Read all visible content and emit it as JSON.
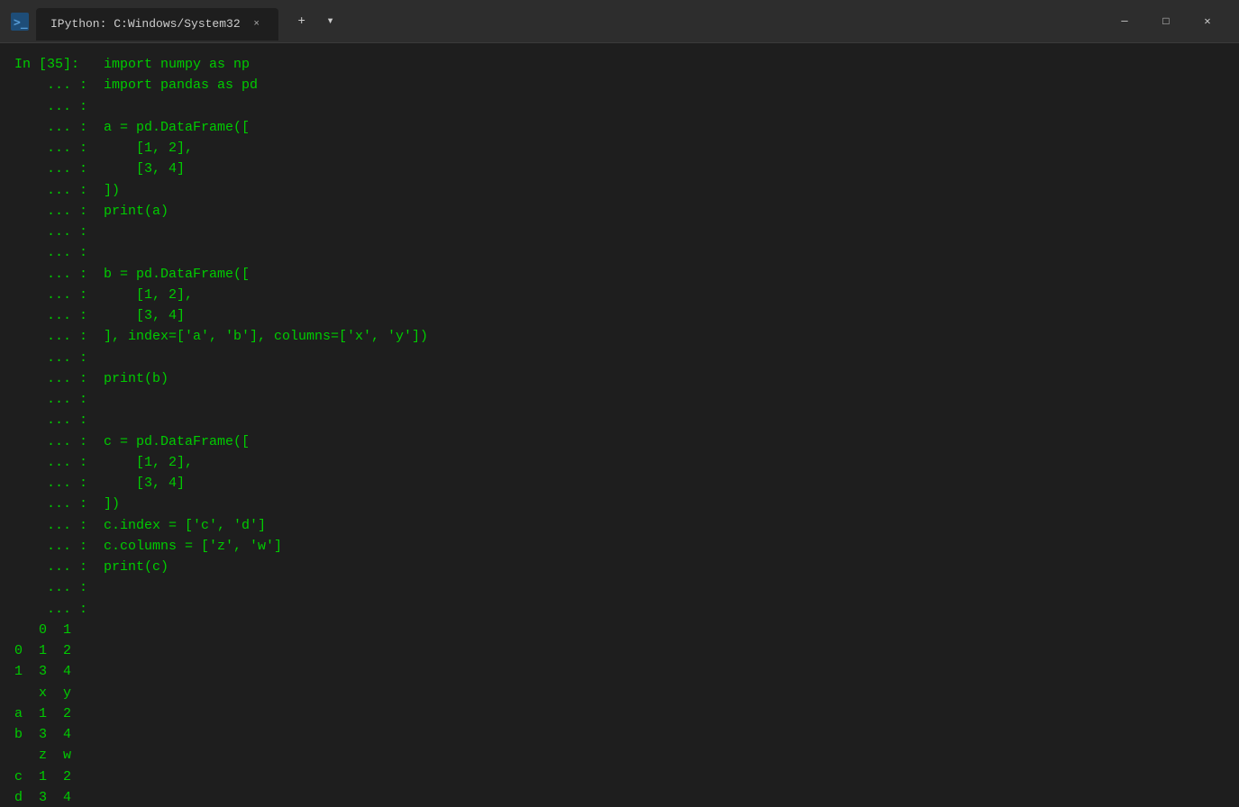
{
  "titlebar": {
    "icon": "⚡",
    "tab_title": "IPython: C:Windows/System32",
    "close_label": "×",
    "new_tab_label": "+",
    "dropdown_label": "▾",
    "minimize_label": "─",
    "maximize_label": "□",
    "winclose_label": "✕"
  },
  "terminal": {
    "lines": [
      {
        "prompt": "In [35]:",
        "code": " import numpy as np"
      },
      {
        "prompt": "    ... :",
        "code": " import pandas as pd"
      },
      {
        "prompt": "    ... :",
        "code": ""
      },
      {
        "prompt": "    ... :",
        "code": " a = pd.DataFrame(["
      },
      {
        "prompt": "    ... :",
        "code": "     [1, 2],"
      },
      {
        "prompt": "    ... :",
        "code": "     [3, 4]"
      },
      {
        "prompt": "    ... :",
        "code": " ])"
      },
      {
        "prompt": "    ... :",
        "code": " print(a)"
      },
      {
        "prompt": "    ... :",
        "code": ""
      },
      {
        "prompt": "    ... :",
        "code": ""
      },
      {
        "prompt": "    ... :",
        "code": " b = pd.DataFrame(["
      },
      {
        "prompt": "    ... :",
        "code": "     [1, 2],"
      },
      {
        "prompt": "    ... :",
        "code": "     [3, 4]"
      },
      {
        "prompt": "    ... :",
        "code": " ], index=['a', 'b'], columns=['x', 'y'])"
      },
      {
        "prompt": "    ... :",
        "code": ""
      },
      {
        "prompt": "    ... :",
        "code": " print(b)"
      },
      {
        "prompt": "    ... :",
        "code": ""
      },
      {
        "prompt": "    ... :",
        "code": ""
      },
      {
        "prompt": "    ... :",
        "code": " c = pd.DataFrame(["
      },
      {
        "prompt": "    ... :",
        "code": "     [1, 2],"
      },
      {
        "prompt": "    ... :",
        "code": "     [3, 4]"
      },
      {
        "prompt": "    ... :",
        "code": " ])"
      },
      {
        "prompt": "    ... :",
        "code": " c.index = ['c', 'd']"
      },
      {
        "prompt": "    ... :",
        "code": " c.columns = ['z', 'w']"
      },
      {
        "prompt": "    ... :",
        "code": " print(c)"
      },
      {
        "prompt": "    ... :",
        "code": ""
      },
      {
        "prompt": "    ... :",
        "code": ""
      }
    ],
    "output": [
      "   0  1",
      "0  1  2",
      "1  3  4",
      "   x  y",
      "a  1  2",
      "b  3  4",
      "   z  w",
      "c  1  2",
      "d  3  4"
    ]
  }
}
